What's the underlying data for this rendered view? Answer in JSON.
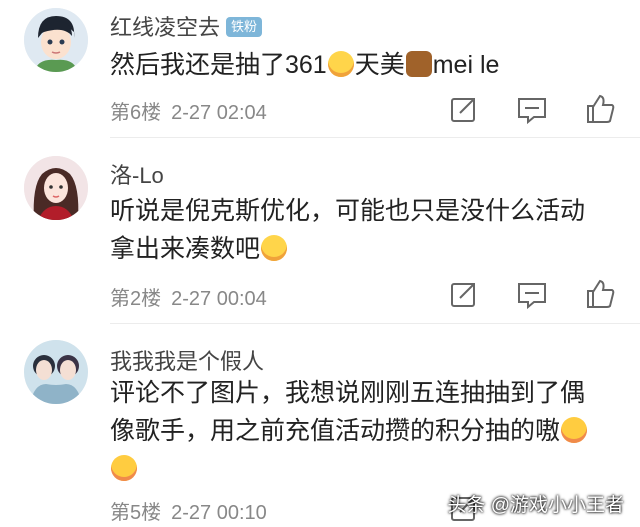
{
  "comments": [
    {
      "username": "红线凌空去",
      "badge": "铁粉",
      "text_a": "然后我还是抽了361",
      "text_b": "天美",
      "text_c": "mei le",
      "floor": "第6楼",
      "time": "2-27 02:04"
    },
    {
      "username": "洛-Lo",
      "text_a": "听说是倪克斯优化，可能也只是没什么活动",
      "text_b": "拿出来凑数吧",
      "floor": "第2楼",
      "time": "2-27 00:04"
    },
    {
      "username": "我我我是个假人",
      "text_a": "评论不了图片，我想说刚刚五连抽抽到了偶",
      "text_b": "像歌手，用之前充值活动攒的积分抽的嗷",
      "floor": "第5楼",
      "time": "2-27 00:10"
    }
  ],
  "watermark": "头条 @游戏小小王者",
  "colors": {
    "badge": "#7eb6d9",
    "divider": "#ececec",
    "meta": "#888888"
  },
  "icons": [
    "share-icon",
    "comment-icon",
    "like-icon",
    "scared-emoji-icon",
    "horse-emoji-icon",
    "love-emoji-icon"
  ]
}
